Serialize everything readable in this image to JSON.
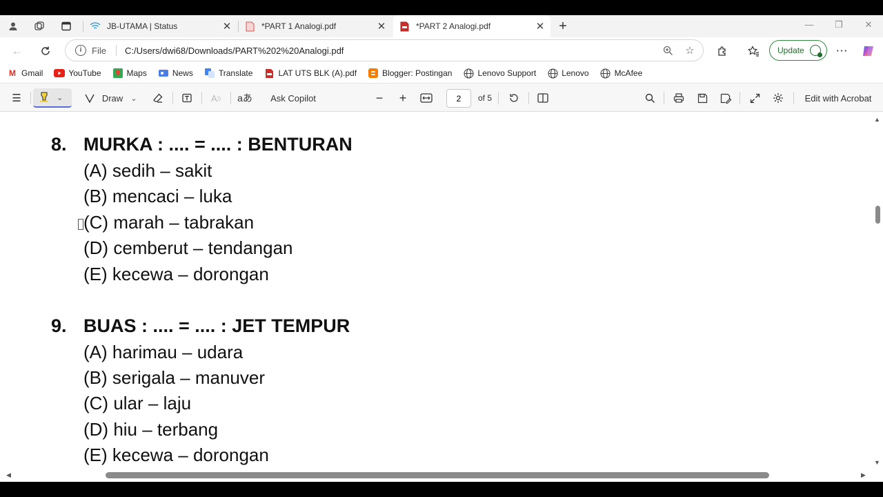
{
  "tabs": [
    {
      "label": "JB-UTAMA | Status",
      "icon": "wifi-icon"
    },
    {
      "label": "*PART 1 Analogi.pdf",
      "icon": "pdf-icon"
    },
    {
      "label": "*PART 2 Analogi.pdf",
      "icon": "pdf-icon"
    }
  ],
  "address": {
    "scheme_label": "File",
    "url": "C:/Users/dwi68/Downloads/PART%202%20Analogi.pdf"
  },
  "update_label": "Update",
  "bookmarks": [
    {
      "label": "Gmail",
      "icon": "gmail-icon"
    },
    {
      "label": "YouTube",
      "icon": "youtube-icon"
    },
    {
      "label": "Maps",
      "icon": "maps-icon"
    },
    {
      "label": "News",
      "icon": "news-icon"
    },
    {
      "label": "Translate",
      "icon": "translate-icon"
    },
    {
      "label": "LAT UTS BLK (A).pdf",
      "icon": "pdf-icon"
    },
    {
      "label": "Blogger: Postingan",
      "icon": "blogger-icon"
    },
    {
      "label": "Lenovo Support",
      "icon": "globe-icon"
    },
    {
      "label": "Lenovo",
      "icon": "globe-icon"
    },
    {
      "label": "McAfee",
      "icon": "globe-icon"
    }
  ],
  "pdf_toolbar": {
    "draw_label": "Draw",
    "ask_copilot_label": "Ask Copilot",
    "page_current": "2",
    "page_total": "of 5",
    "edit_acrobat_label": "Edit with Acrobat"
  },
  "questions": [
    {
      "number": "8.",
      "text": "MURKA : .... = .... : BENTURAN",
      "options": [
        "(A) sedih – sakit",
        "(B) mencaci – luka",
        "(C) marah – tabrakan",
        "(D) cemberut – tendangan",
        "(E) kecewa – dorongan"
      ]
    },
    {
      "number": "9.",
      "text": "BUAS : .... = .... : JET TEMPUR",
      "options": [
        "(A) harimau – udara",
        "(B) serigala – manuver",
        "(C) ular – laju",
        "(D) hiu – terbang",
        "(E) kecewa – dorongan"
      ]
    }
  ]
}
